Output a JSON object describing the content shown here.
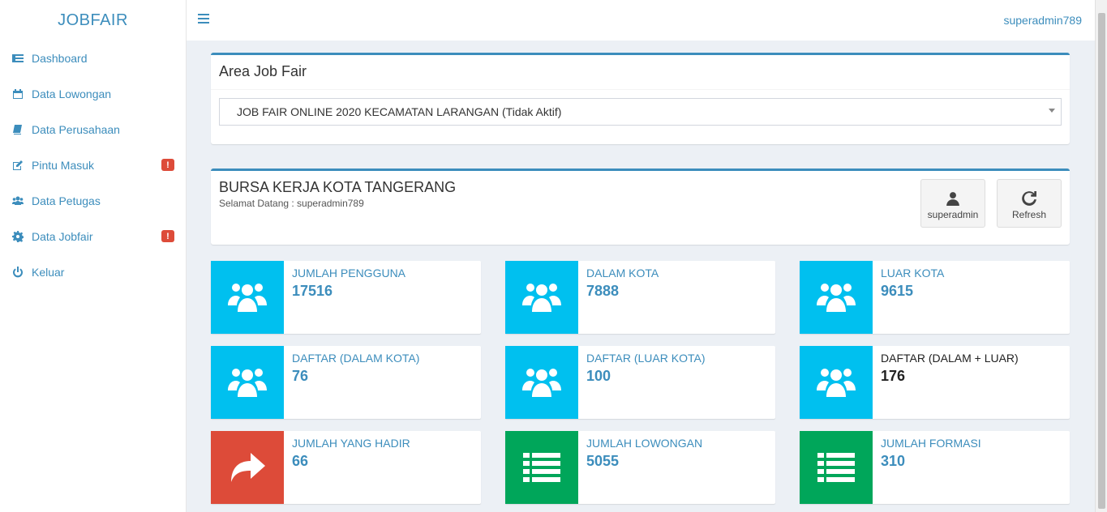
{
  "brand": "JOBFAIR",
  "user": "superadmin789",
  "sidebar": {
    "items": [
      {
        "label": "Dashboard"
      },
      {
        "label": "Data Lowongan"
      },
      {
        "label": "Data Perusahaan"
      },
      {
        "label": "Pintu Masuk",
        "badge": "!"
      },
      {
        "label": "Data Petugas"
      },
      {
        "label": "Data Jobfair",
        "badge": "!"
      },
      {
        "label": "Keluar"
      }
    ]
  },
  "area": {
    "title": "Area Job Fair",
    "selected": "JOB FAIR ONLINE 2020 KECAMATAN LARANGAN (Tidak Aktif)"
  },
  "welcome": {
    "title": "BURSA KERJA KOTA TANGERANG",
    "subtitle": "Selamat Datang : superadmin789",
    "user_button": "superadmin",
    "refresh_button": "Refresh"
  },
  "stats": [
    {
      "label": "JUMLAH PENGGUNA",
      "value": "17516"
    },
    {
      "label": "DALAM KOTA",
      "value": "7888"
    },
    {
      "label": "LUAR KOTA",
      "value": "9615"
    },
    {
      "label": "DAFTAR (DALAM KOTA)",
      "value": "76"
    },
    {
      "label": "DAFTAR (LUAR KOTA)",
      "value": "100"
    },
    {
      "label": "DAFTAR (DALAM + LUAR)",
      "value": "176"
    },
    {
      "label": "JUMLAH YANG HADIR",
      "value": "66"
    },
    {
      "label": "JUMLAH LOWONGAN",
      "value": "5055"
    },
    {
      "label": "JUMLAH FORMASI",
      "value": "310"
    }
  ],
  "colors": {
    "primary": "#3c8dbc",
    "aqua": "#00c0ef",
    "red": "#dd4b39",
    "green": "#00a65a"
  }
}
